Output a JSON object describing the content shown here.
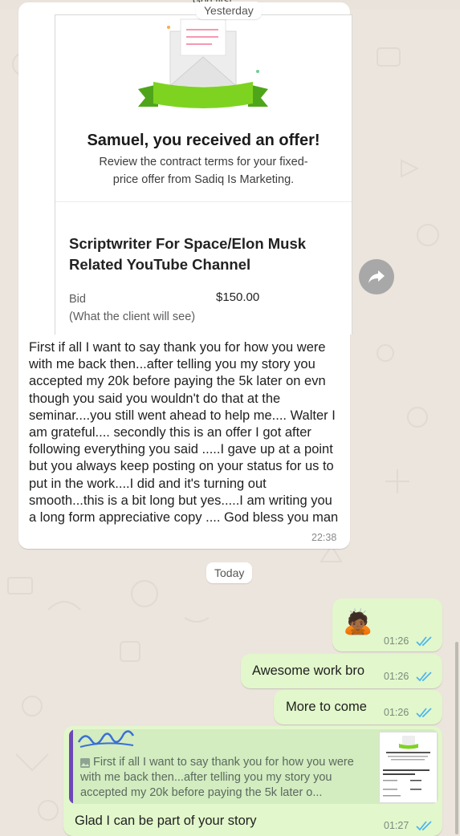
{
  "header": {
    "partial_top_text": "God first",
    "date_yesterday": "Yesterday",
    "date_today": "Today"
  },
  "offer_card": {
    "title": "Samuel, you received an offer!",
    "description": "Review the contract terms for your fixed-price offer from Sadiq Is Marketing.",
    "job_title": "Scriptwriter For Space/Elon Musk Related YouTube Channel",
    "bid_label": "Bid",
    "bid_sublabel": "(What the client will see)",
    "bid_value": "$150.00"
  },
  "messages": {
    "incoming_long": {
      "text": "First if all I want to say thank you for how you were with me back then...after telling you my story you accepted my 20k  before paying the 5k later on evn though you said you wouldn't do that at the seminar....you still went ahead to help me.... Walter I am grateful.... secondly this is an offer I got after following everything you said .....I gave up at a point but you always keep posting on your status for us to put in the work....I did and it's turning out smooth...this is a bit long but yes.....I am writing you a long form appreciative copy .... God bless you man",
      "time": "22:38"
    },
    "outgoing": [
      {
        "text": "🙇🏾",
        "time": "01:26"
      },
      {
        "text": "Awesome work bro",
        "time": "01:26"
      },
      {
        "text": "More to come",
        "time": "01:26"
      }
    ],
    "reply": {
      "quoted_text": "First if all I want to say thank you for how you were with me back then...after telling you my story you accepted my 20k  before paying the 5k later o...",
      "text": "Glad I can be part of your story",
      "time": "01:27"
    }
  },
  "colors": {
    "chat_background": "#ece5dd",
    "incoming_bubble": "#ffffff",
    "outgoing_bubble": "#e2f7cb",
    "read_ticks": "#4fb6ec",
    "ribbon_green": "#7ed321",
    "quote_bar": "#6d47b8"
  },
  "icons": [
    "forward-icon",
    "read-receipt-icon",
    "image-icon",
    "envelope-icon"
  ]
}
